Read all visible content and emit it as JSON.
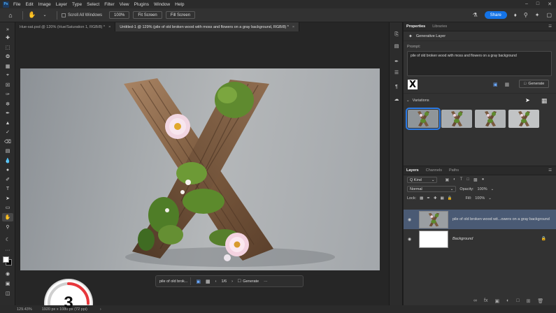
{
  "app": {
    "logo": "Ps"
  },
  "menu": [
    "File",
    "Edit",
    "Image",
    "Layer",
    "Type",
    "Select",
    "Filter",
    "View",
    "Plugins",
    "Window",
    "Help"
  ],
  "options": {
    "scroll_all_label": "Scroll All Windows",
    "zoom_btn": "100%",
    "fit_btn": "Fit Screen",
    "fill_btn": "Fill Screen",
    "share_label": "Share"
  },
  "tabs": [
    {
      "label": "Hue-sat.psd @ 120% (Hue/Saturation 1, RGB/8) *",
      "active": false
    },
    {
      "label": "Untitled-1 @ 129% (pile of old broken wood with moss and flowers on a gray background, RGB/8) *",
      "active": true
    }
  ],
  "gen_bar": {
    "prompt_short": "pile of old brok...",
    "counter": "1/6",
    "generate_label": "Generate",
    "more": "···"
  },
  "step_badge": {
    "number": "3",
    "progress": 0.25,
    "color": "#e8373c"
  },
  "status": {
    "zoom": "129.43%",
    "dims": "1920 px x 1080 px (72 ppi)"
  },
  "properties": {
    "tabs": [
      "Properties",
      "Libraries"
    ],
    "layer_type": "Generative Layer",
    "prompt_label": "Prompt:",
    "prompt_text": "pile of old broken wood with moss and flowers on a gray background",
    "ref_glyph": "X",
    "generate_label": "Generate",
    "variations_label": "Variations",
    "variations": [
      {
        "tone": "#8f9599",
        "selected": true
      },
      {
        "tone": "#a9adb0",
        "selected": false
      },
      {
        "tone": "#b2b5b7",
        "selected": false
      },
      {
        "tone": "#c2c4c5",
        "selected": false
      }
    ]
  },
  "layers": {
    "tabs": [
      "Layers",
      "Channels",
      "Paths"
    ],
    "kind_label": "Q Kind",
    "blend_mode": "Normal",
    "opacity_label": "Opacity:",
    "opacity_value": "100%",
    "lock_label": "Lock:",
    "fill_label": "Fill:",
    "fill_value": "100%",
    "items": [
      {
        "name": "pile of old broken wood wit...owers on a gray background",
        "selected": true
      },
      {
        "name": "Background",
        "selected": false
      }
    ]
  },
  "colors": {
    "accent": "#1473e6",
    "selection": "#2c7be5"
  }
}
